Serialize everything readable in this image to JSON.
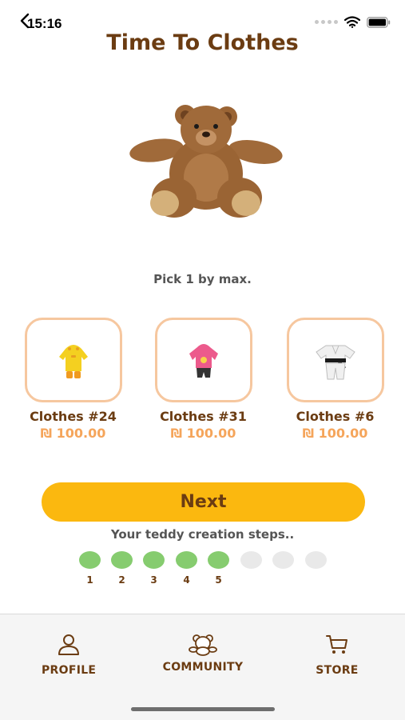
{
  "status_bar": {
    "time": "15:16"
  },
  "header": {
    "title": "Time To Clothes"
  },
  "instruction": "Pick 1 by max.",
  "clothes": [
    {
      "name": "Clothes #24",
      "price": "₪ 100.00",
      "icon": "yellow-raincoat-outfit"
    },
    {
      "name": "Clothes #31",
      "price": "₪ 100.00",
      "icon": "pink-hoodie-outfit"
    },
    {
      "name": "Clothes #6",
      "price": "₪ 100.00",
      "icon": "karate-gi-outfit"
    }
  ],
  "next_label": "Next",
  "steps": {
    "caption": "Your teddy creation steps..",
    "labels": [
      "1",
      "2",
      "3",
      "4",
      "5"
    ],
    "completed": 5,
    "total": 8
  },
  "tabs": [
    {
      "label": "PROFILE",
      "icon": "person-icon"
    },
    {
      "label": "COMMUNITY",
      "icon": "bear-icon"
    },
    {
      "label": "STORE",
      "icon": "cart-icon"
    }
  ],
  "colors": {
    "title": "#6b3c12",
    "accent_button": "#fbb80f",
    "price": "#f5a55b",
    "card_border": "#f6c79f",
    "step_done": "#86cc6f",
    "step_todo": "#e9e9e9"
  }
}
